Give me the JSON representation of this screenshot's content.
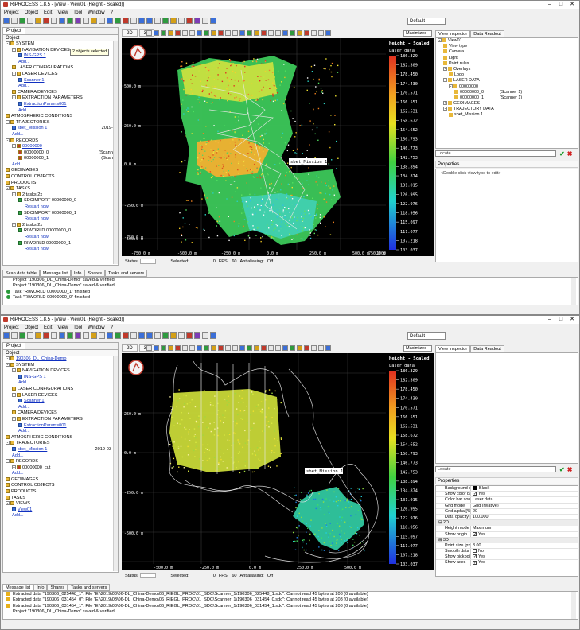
{
  "window1": {
    "title": "RiPROCESS 1.8.5 - [View - View01 (Height - Scaled)]",
    "menu": [
      "Project",
      "Object",
      "Edit",
      "View",
      "Tool",
      "Window",
      "?"
    ],
    "style_combo": "Default",
    "view_tabs": [
      "2D",
      "3D"
    ],
    "maximized": "Maximized",
    "left_tabs": [
      "Project"
    ],
    "object_header": "Object",
    "tooltip": "2 objects selected",
    "tree": [
      {
        "indent": 0,
        "exp": "-",
        "icon": "folder",
        "text": "SYSTEM"
      },
      {
        "indent": 1,
        "exp": "-",
        "icon": "folder",
        "text": "NAVIGATION DEVICES"
      },
      {
        "indent": 2,
        "icon": "dev",
        "text": "INS-GPS 1",
        "link": true
      },
      {
        "indent": 2,
        "text": "Add...",
        "add": true
      },
      {
        "indent": 1,
        "icon": "folder",
        "text": "LASER CONFIGURATIONS"
      },
      {
        "indent": 1,
        "exp": "-",
        "icon": "folder",
        "text": "LASER DEVICES"
      },
      {
        "indent": 2,
        "icon": "dev",
        "text": "Scanner 1",
        "link": true
      },
      {
        "indent": 2,
        "text": "Add...",
        "add": true
      },
      {
        "indent": 1,
        "icon": "folder",
        "text": "CAMERA DEVICES"
      },
      {
        "indent": 1,
        "exp": "-",
        "icon": "folder",
        "text": "EXTRACTION PARAMETERS"
      },
      {
        "indent": 2,
        "icon": "dev",
        "text": "ExtractionParams001",
        "link": true
      },
      {
        "indent": 2,
        "text": "Add...",
        "add": true
      },
      {
        "indent": 0,
        "icon": "folder",
        "text": "ATMOSPHERIC CONDITIONS"
      },
      {
        "indent": 0,
        "exp": "-",
        "icon": "folder",
        "text": "TRAJECTORIES"
      },
      {
        "indent": 1,
        "icon": "dev",
        "text": "sbet_Mission 1",
        "link": true,
        "right": "2019-0"
      },
      {
        "indent": 1,
        "text": "Add...",
        "add": true
      },
      {
        "indent": 0,
        "exp": "-",
        "icon": "folder",
        "text": "RECORDS"
      },
      {
        "indent": 1,
        "exp": "-",
        "icon": "rec",
        "text": "00000000",
        "link": true
      },
      {
        "indent": 2,
        "icon": "rec",
        "text": "00000000_0",
        "right": "(Scanne"
      },
      {
        "indent": 2,
        "icon": "rec",
        "text": "00000000_1",
        "right": "(Scann"
      },
      {
        "indent": 1,
        "text": "Add...",
        "add": true
      },
      {
        "indent": 0,
        "icon": "folder",
        "text": "GEOIMAGES"
      },
      {
        "indent": 0,
        "icon": "folder",
        "text": "CONTROL OBJECTS"
      },
      {
        "indent": 0,
        "icon": "folder",
        "text": "PRODUCTS"
      },
      {
        "indent": 0,
        "exp": "-",
        "icon": "folder",
        "text": "TASKS"
      },
      {
        "indent": 1,
        "exp": "-",
        "icon": "folder",
        "text": "2 tasks 2x"
      },
      {
        "indent": 2,
        "icon": "ok",
        "text": "SDCIMPORT 00000000_0"
      },
      {
        "indent": 3,
        "text": "Restart now!",
        "add": true
      },
      {
        "indent": 2,
        "icon": "ok",
        "text": "SDCIMPORT 00000000_1"
      },
      {
        "indent": 3,
        "text": "Restart now!",
        "add": true
      },
      {
        "indent": 1,
        "exp": "-",
        "icon": "folder",
        "text": "2 tasks 2x"
      },
      {
        "indent": 2,
        "icon": "ok",
        "text": "RIWORLD 00000000_0"
      },
      {
        "indent": 3,
        "text": "Restart now!",
        "add": true
      },
      {
        "indent": 2,
        "icon": "ok",
        "text": "RIWORLD 00000000_1"
      },
      {
        "indent": 3,
        "text": "Restart now!",
        "add": true
      }
    ],
    "colorbar": {
      "title": "Height - Scaled",
      "subtitle": "Laser data",
      "ticks": [
        "186.329",
        "182.309",
        "178.450",
        "174.430",
        "170.571",
        "166.551",
        "162.531",
        "158.672",
        "154.652",
        "150.793",
        "146.773",
        "142.753",
        "138.894",
        "134.874",
        "131.015",
        "126.995",
        "122.976",
        "118.956",
        "115.097",
        "111.077",
        "107.218",
        "103.037"
      ]
    },
    "axis_y": [
      "500.0 m",
      "250.0 m",
      "0.0 m",
      "-250.0 m",
      "-500.0 m",
      "-750.0 m"
    ],
    "axis_x": [
      "-750.0 m",
      "-500.0 m",
      "-250.0 m",
      "0.0 m",
      "250.0 m",
      "500.0 m",
      "750.0 m",
      "1000.0 m"
    ],
    "traj_label": "sbet_Mission 1",
    "status": {
      "status": "Status:",
      "selected": "Selected:",
      "sel_val": "0",
      "fps": "FPS:",
      "fps_val": "60",
      "anti": "Antialiasing:",
      "anti_val": "Off"
    },
    "right_tabs": [
      "View inspector",
      "Data Readout"
    ],
    "vi_tree": [
      {
        "indent": 0,
        "exp": "-",
        "text": "View01"
      },
      {
        "indent": 1,
        "text": "View type"
      },
      {
        "indent": 1,
        "text": "Camera"
      },
      {
        "indent": 1,
        "text": "Light"
      },
      {
        "indent": 1,
        "text": "Point rules"
      },
      {
        "indent": 1,
        "exp": "-",
        "text": "Overlays"
      },
      {
        "indent": 2,
        "text": "Logo"
      },
      {
        "indent": 1,
        "exp": "-",
        "text": "LASER DATA"
      },
      {
        "indent": 2,
        "exp": "-",
        "text": "00000000"
      },
      {
        "indent": 3,
        "text": "00000000_0",
        "right": "(Scanner 1)"
      },
      {
        "indent": 3,
        "text": "00000000_1",
        "right": "(Scanner 1)"
      },
      {
        "indent": 1,
        "exp": "+",
        "text": "GEOIMAGES"
      },
      {
        "indent": 1,
        "exp": "-",
        "text": "TRAJECTORY DATA"
      },
      {
        "indent": 2,
        "text": "sbet_Mission 1"
      }
    ],
    "locate": "Locate",
    "properties": "Properties",
    "props_hint": "<Double click view type to edit>",
    "bottom_tabs": [
      "Scan data table",
      "Message list",
      "Info",
      "Shares",
      "Tasks and servers"
    ],
    "messages": [
      {
        "icon": "none",
        "text": "Project \"190306_DL_China-Demo\" saved & verified"
      },
      {
        "icon": "none",
        "text": "Project \"190306_DL_China-Demo\" saved & verified"
      },
      {
        "icon": "ok",
        "text": "Task \"RIWORLD 00000000_1\" finished"
      },
      {
        "icon": "ok",
        "text": "Task \"RIWORLD 00000000_0\" finished"
      }
    ]
  },
  "window2": {
    "title": "RiPROCESS 1.8.5 - [View - View01 (Height - Scaled)]",
    "menu": [
      "Project",
      "Object",
      "Edit",
      "View",
      "Tool",
      "Window",
      "?"
    ],
    "style_combo": "Default",
    "view_tabs": [
      "2D",
      "3D"
    ],
    "maximized": "Maximized",
    "left_tabs": [
      "Project"
    ],
    "object_header": "Object",
    "tree": [
      {
        "indent": 0,
        "exp": "-",
        "icon": "proj",
        "text": "190306_DL_China-Demo",
        "link": true
      },
      {
        "indent": 0,
        "exp": "-",
        "icon": "folder",
        "text": "SYSTEM"
      },
      {
        "indent": 1,
        "exp": "-",
        "icon": "folder",
        "text": "NAVIGATION DEVICES"
      },
      {
        "indent": 2,
        "icon": "dev",
        "text": "INS-GPS 1",
        "link": true
      },
      {
        "indent": 2,
        "text": "Add...",
        "add": true
      },
      {
        "indent": 1,
        "icon": "folder",
        "text": "LASER CONFIGURATIONS"
      },
      {
        "indent": 1,
        "exp": "-",
        "icon": "folder",
        "text": "LASER DEVICES"
      },
      {
        "indent": 2,
        "icon": "dev",
        "text": "Scanner 1",
        "link": true
      },
      {
        "indent": 2,
        "text": "Add...",
        "add": true
      },
      {
        "indent": 1,
        "icon": "folder",
        "text": "CAMERA DEVICES"
      },
      {
        "indent": 1,
        "exp": "-",
        "icon": "folder",
        "text": "EXTRACTION PARAMETERS"
      },
      {
        "indent": 2,
        "icon": "dev",
        "text": "ExtractionParams001",
        "link": true
      },
      {
        "indent": 2,
        "text": "Add...",
        "add": true
      },
      {
        "indent": 0,
        "icon": "folder",
        "text": "ATMOSPHERIC CONDITIONS"
      },
      {
        "indent": 0,
        "exp": "-",
        "icon": "folder",
        "text": "TRAJECTORIES"
      },
      {
        "indent": 1,
        "icon": "dev",
        "text": "sbet_Mission 1",
        "link": true,
        "right": "2019-03-0"
      },
      {
        "indent": 1,
        "text": "Add...",
        "add": true
      },
      {
        "indent": 0,
        "exp": "-",
        "icon": "folder",
        "text": "RECORDS"
      },
      {
        "indent": 1,
        "exp": "+",
        "icon": "rec",
        "text": "00000000_cut"
      },
      {
        "indent": 1,
        "text": "Add...",
        "add": true
      },
      {
        "indent": 0,
        "icon": "folder",
        "text": "GEOIMAGES"
      },
      {
        "indent": 0,
        "icon": "folder",
        "text": "CONTROL OBJECTS"
      },
      {
        "indent": 0,
        "icon": "folder",
        "text": "PRODUCTS"
      },
      {
        "indent": 0,
        "icon": "folder",
        "text": "TASKS"
      },
      {
        "indent": 0,
        "exp": "-",
        "icon": "folder",
        "text": "VIEWS"
      },
      {
        "indent": 1,
        "icon": "dev",
        "text": "View01",
        "link": true
      },
      {
        "indent": 1,
        "text": "Add...",
        "add": true
      }
    ],
    "colorbar": {
      "title": "Height - Scaled",
      "subtitle": "Laser data",
      "ticks": [
        "186.329",
        "182.309",
        "178.450",
        "174.430",
        "170.571",
        "166.551",
        "162.531",
        "158.672",
        "154.652",
        "150.793",
        "146.773",
        "142.753",
        "138.894",
        "134.874",
        "131.015",
        "126.995",
        "122.976",
        "118.956",
        "115.097",
        "111.077",
        "107.218",
        "103.037"
      ]
    },
    "axis_y": [
      "250.0 m",
      "0.0 m",
      "-250.0 m",
      "-500.0 m"
    ],
    "axis_x": [
      "-500.0 m",
      "-250.0 m",
      "0.0 m",
      "250.0 m",
      "500.0 m"
    ],
    "traj_label": "sbet_Mission 1",
    "status": {
      "status": "Status:",
      "selected": "Selected:",
      "sel_val": "0",
      "fps": "FPS:",
      "fps_val": "60",
      "anti": "Antialiasing:",
      "anti_val": "Off"
    },
    "right_tabs": [
      "View inspector",
      "Data Readout"
    ],
    "locate": "Locate",
    "properties": "Properties",
    "props": [
      {
        "type": "row",
        "k": "Background co",
        "swatch": "#000000",
        "v": "Black"
      },
      {
        "type": "row",
        "k": "Show color bar",
        "check": true,
        "v": "Yes"
      },
      {
        "type": "row",
        "k": "Color bar sourc",
        "v": "Laser data"
      },
      {
        "type": "row",
        "k": "Grid mode",
        "v": "Grid (relative)"
      },
      {
        "type": "row",
        "k": "Grid alpha [%]",
        "v": "20"
      },
      {
        "type": "row",
        "k": "Data opacity [%]",
        "v": "100.000"
      },
      {
        "type": "sec",
        "k": "2D"
      },
      {
        "type": "row",
        "k": "Height mode",
        "v": "Maximum"
      },
      {
        "type": "row",
        "k": "Show origin",
        "check": true,
        "v": "Yes"
      },
      {
        "type": "sec",
        "k": "3D"
      },
      {
        "type": "row",
        "k": "Point size [px]",
        "v": "3.00"
      },
      {
        "type": "row",
        "k": "Smooth data",
        "check": false,
        "v": "No"
      },
      {
        "type": "row",
        "k": "Show pickpoi",
        "check": true,
        "v": "Yes"
      },
      {
        "type": "row",
        "k": "Show axes",
        "check": true,
        "v": "Yes"
      }
    ],
    "bottom_tabs": [
      "Message list",
      "Info",
      "Shares",
      "Tasks and servers"
    ],
    "messages": [
      {
        "icon": "warn",
        "text": "Extracted data \"190306_025448_1\": File \"E:\\2019\\03\\06-DL_China-Demo\\06_RIEGL_PROC\\01_SDC\\Scanner_1\\190306_025448_1.sdc\": Cannot read 45 bytes at 208 (0 available)"
      },
      {
        "icon": "warn",
        "text": "Extracted data \"190306_031454_0\": File \"E:\\2019\\03\\06-DL_China-Demo\\06_RIEGL_PROC\\01_SDC\\Scanner_1\\190306_031454_0.sdc\": Cannot read 45 bytes at 208 (0 available)"
      },
      {
        "icon": "warn",
        "text": "Extracted data \"190306_031454_1\": File \"E:\\2019\\03\\06-DL_China-Demo\\06_RIEGL_PROC\\01_SDC\\Scanner_1\\190306_031454_1.sdc\": Cannot read 45 bytes at 208 (0 available)"
      },
      {
        "icon": "none",
        "text": "Project \"190306_DL_China-Demo\" saved & verified"
      }
    ]
  }
}
